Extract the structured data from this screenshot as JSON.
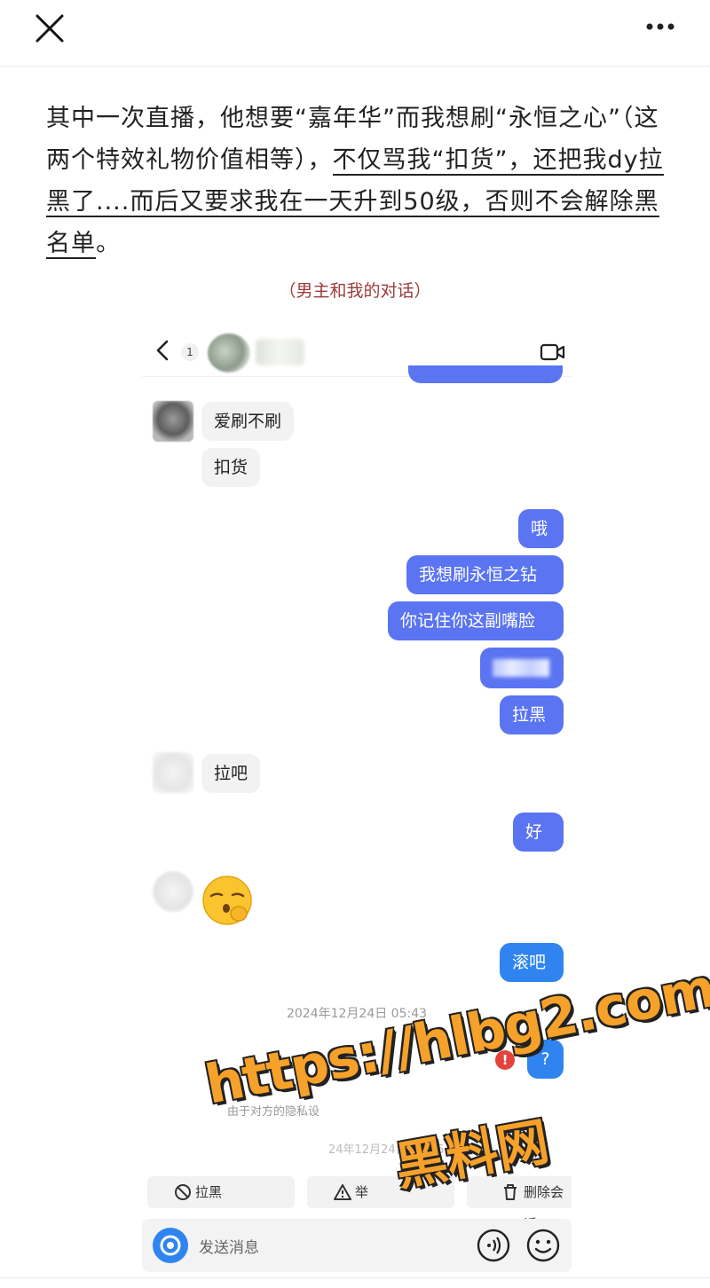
{
  "article": {
    "p1": "其中一次直播，他想要“嘉年华”而我想刷“永恒之心”（这两个特效礼物价值相等），",
    "p2": "不仅骂我“扣货”，还把我dy拉黑了....而后又要求我在一天升到50级，否则不会解除黑名单",
    "p3": "。"
  },
  "caption": "（男主和我的对话）",
  "chat": {
    "unread": "1",
    "messages": {
      "m1": "爱刷不刷",
      "m2": "扣货",
      "m3": "哦",
      "m4": "我想刷永恒之钻",
      "m5": "你记住你这副嘴脸",
      "m6": "拉黑",
      "m7": "拉吧",
      "m8": "好",
      "m9": "滚吧",
      "m10": "?"
    },
    "timestamp": "2024年12月24日 05:43",
    "privacy_note": "由于对方的隐私设",
    "timestamp2": "24年12月24日 15:36",
    "actions": {
      "block": "拉黑",
      "report": "举",
      "delete": "删除会话"
    },
    "input_placeholder": "发送消息"
  },
  "watermark": {
    "url": "https://hlbg2.com",
    "name": "黑料网"
  },
  "colors": {
    "outgoing": "#5a74f2",
    "outgoing_alt": "#2f84f0",
    "incoming": "#f2f2f3",
    "error": "#e2433c",
    "watermark": "#f6a12a"
  }
}
